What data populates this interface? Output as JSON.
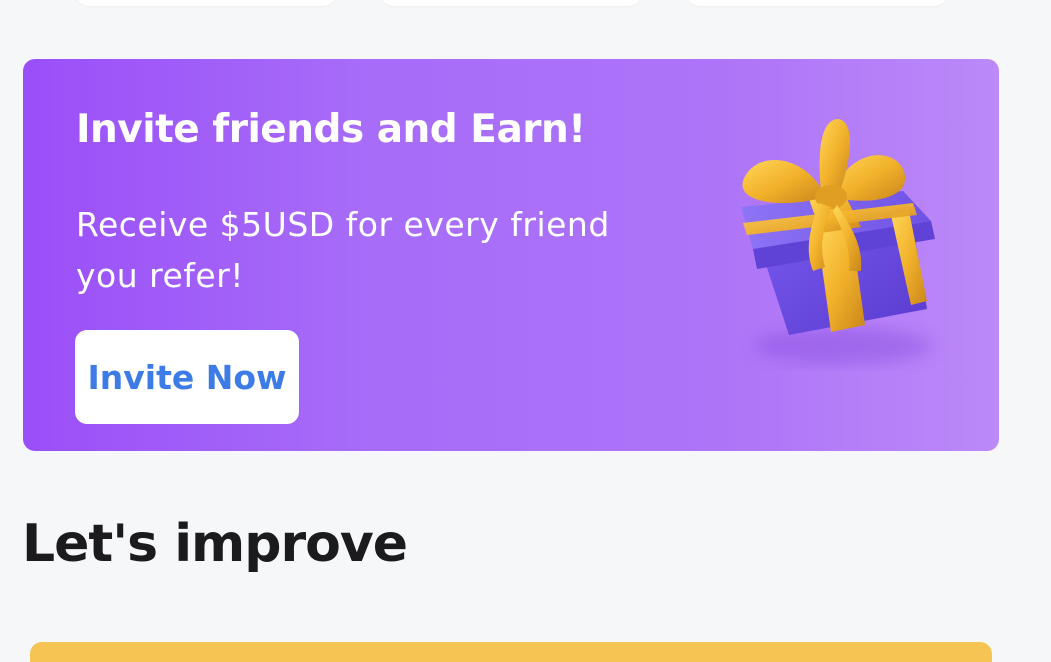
{
  "invite": {
    "title": "Invite friends and Earn!",
    "subtitle": "Receive $5USD for every friend you refer!",
    "button_label": "Invite Now",
    "image_icon": "gift-box-icon"
  },
  "section": {
    "title": "Let's improve"
  },
  "colors": {
    "banner_start": "#9a4ff8",
    "banner_end": "#bb89f8",
    "button_text": "#3d7be6",
    "gift_box": "#6f4ee6",
    "gift_ribbon": "#f2b52c",
    "page_background": "#f6f7f9",
    "next_card": "#f6c452"
  }
}
